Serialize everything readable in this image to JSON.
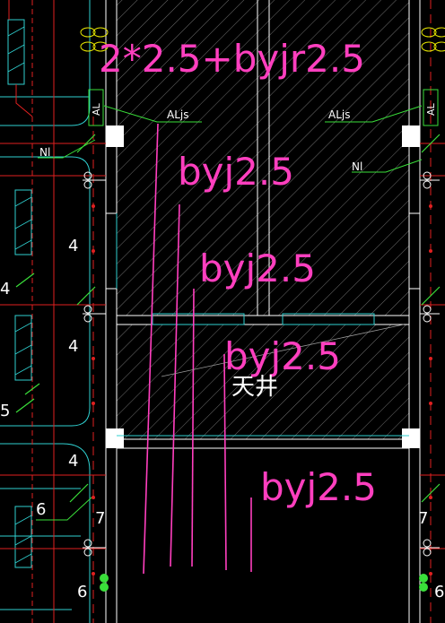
{
  "colors": {
    "background": "#000000",
    "hatch": "#9a9a9a",
    "wall": "#ffffff",
    "magenta": "#ff3fbf",
    "cyan": "#2fd0d0",
    "green": "#3adf3a",
    "red": "#e02020",
    "yellow": "#e6e600"
  },
  "labels": {
    "cable_spec_top": "2*2.5+byjr2.5",
    "byj_1": "byj2.5",
    "byj_2": "byj2.5",
    "byj_3": "byj2.5",
    "byj_4": "byj2.5",
    "panel_left": "ALjs",
    "panel_right": "ALjs",
    "neutral_left": "Nl",
    "neutral_right": "Nl",
    "al_left": "AL",
    "al_right": "AL",
    "shaft": "天井",
    "num_4a": "4",
    "num_4b": "4",
    "num_4c": "4",
    "num_4d": "4",
    "num_5": "5",
    "num_6a": "6",
    "num_6b": "6",
    "num_6c": "6",
    "num_7a": "7",
    "num_7b": "7"
  }
}
